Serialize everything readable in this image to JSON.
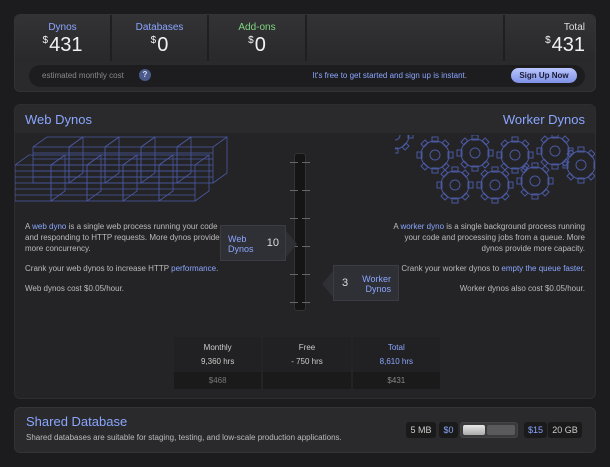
{
  "costs": {
    "dynos": {
      "label": "Dynos",
      "currency": "$",
      "value": "431"
    },
    "databases": {
      "label": "Databases",
      "currency": "$",
      "value": "0"
    },
    "addons": {
      "label": "Add-ons",
      "currency": "$",
      "value": "0"
    },
    "total": {
      "label": "Total",
      "currency": "$",
      "value": "431"
    }
  },
  "estimate": {
    "text": "estimated monthly cost",
    "help": "?",
    "free_text": "It's free to get started and sign up is instant.",
    "signup_label": "Sign Up Now"
  },
  "dynos": {
    "web_title": "Web Dynos",
    "worker_title": "Worker Dynos",
    "web_desc": {
      "p1_pre": "A ",
      "p1_link": "web dyno",
      "p1_post": " is a single web process running your code and responding to HTTP requests. More dynos provide more concurrency.",
      "p2_pre": "Crank your web dynos to increase HTTP ",
      "p2_link": "performance",
      "p2_post": ".",
      "p3": "Web dynos cost $0.05/hour."
    },
    "worker_desc": {
      "p1_pre": "A ",
      "p1_link": "worker dyno",
      "p1_post": " is a single background process running your code and processing jobs from a queue. More dynos provide more capacity.",
      "p2_pre": "Crank your worker dynos to ",
      "p2_link": "empty the queue faster",
      "p2_post": ".",
      "p3": "Worker dynos also cost $0.05/hour."
    },
    "web_flag": {
      "name_line1": "Web",
      "name_line2": "Dynos",
      "count": "10"
    },
    "worker_flag": {
      "name_line1": "Worker",
      "name_line2": "Dynos",
      "count": "3"
    }
  },
  "hours": {
    "monthly": {
      "label": "Monthly",
      "hrs": "9,360 hrs",
      "money": "$468"
    },
    "free": {
      "label": "Free",
      "hrs": "- 750 hrs",
      "money": ""
    },
    "total": {
      "label": "Total",
      "hrs": "8,610 hrs",
      "money": "$431"
    }
  },
  "database": {
    "title": "Shared Database",
    "desc": "Shared databases are suitable for staging, testing, and low-scale production applications.",
    "size_small": "5 MB",
    "price_small": "$0",
    "price_large": "$15",
    "size_large": "20 GB"
  },
  "colors": {
    "accent": "#8aa6ff",
    "addons": "#7fd67f",
    "signup": "#9fb0f5"
  }
}
